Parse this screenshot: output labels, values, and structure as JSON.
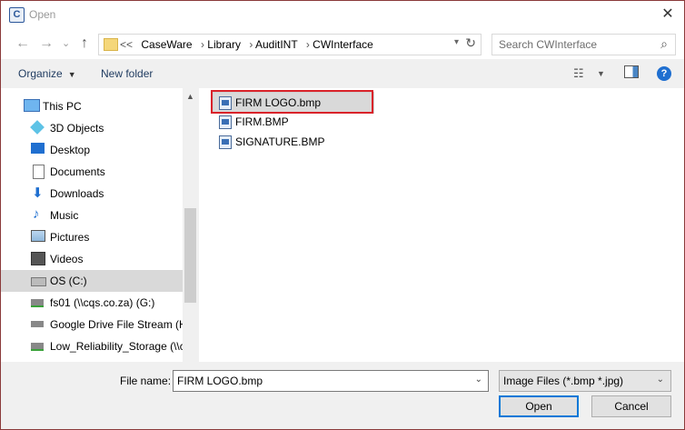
{
  "window": {
    "title": "Open",
    "app_icon_letter": "C"
  },
  "navigation": {
    "back_glyph": "←",
    "forward_glyph": "→",
    "recent_glyph": "⌄",
    "up_glyph": "↑"
  },
  "address": {
    "overflow": "<<",
    "crumbs": [
      "CaseWare",
      "Library",
      "AuditINT",
      "CWInterface"
    ]
  },
  "search": {
    "placeholder": "Search CWInterface"
  },
  "toolbar": {
    "organize_label": "Organize",
    "new_folder_label": "New folder",
    "help_label": "?"
  },
  "nav_pane": {
    "items": [
      {
        "label": "This PC",
        "icon": "computer-icon",
        "selected": false
      },
      {
        "label": "3D Objects",
        "icon": "cube-icon",
        "selected": false
      },
      {
        "label": "Desktop",
        "icon": "desktop-icon",
        "selected": false
      },
      {
        "label": "Documents",
        "icon": "document-icon",
        "selected": false
      },
      {
        "label": "Downloads",
        "icon": "download-icon",
        "selected": false
      },
      {
        "label": "Music",
        "icon": "music-icon",
        "selected": false
      },
      {
        "label": "Pictures",
        "icon": "pictures-icon",
        "selected": false
      },
      {
        "label": "Videos",
        "icon": "video-icon",
        "selected": false
      },
      {
        "label": "OS (C:)",
        "icon": "drive-icon",
        "selected": true
      },
      {
        "label": "fs01 (\\\\cqs.co.za) (G:)",
        "icon": "network-drive-icon",
        "selected": false
      },
      {
        "label": "Google Drive File Stream (H",
        "icon": "drive-icon",
        "selected": false
      },
      {
        "label": "Low_Reliability_Storage (\\\\c",
        "icon": "network-drive-icon",
        "selected": false
      }
    ]
  },
  "files": [
    {
      "name": "FIRM LOGO.bmp",
      "selected": true
    },
    {
      "name": "FIRM.BMP",
      "selected": false
    },
    {
      "name": "SIGNATURE.BMP",
      "selected": false
    }
  ],
  "bottom": {
    "file_name_label": "File name:",
    "file_name_value": "FIRM LOGO.bmp",
    "filter_value": "Image Files (*.bmp *.jpg)",
    "open_label": "Open",
    "cancel_label": "Cancel"
  },
  "colors": {
    "highlight_border": "#d9232a",
    "accent": "#0078d7",
    "selection": "#d9d9d9"
  }
}
